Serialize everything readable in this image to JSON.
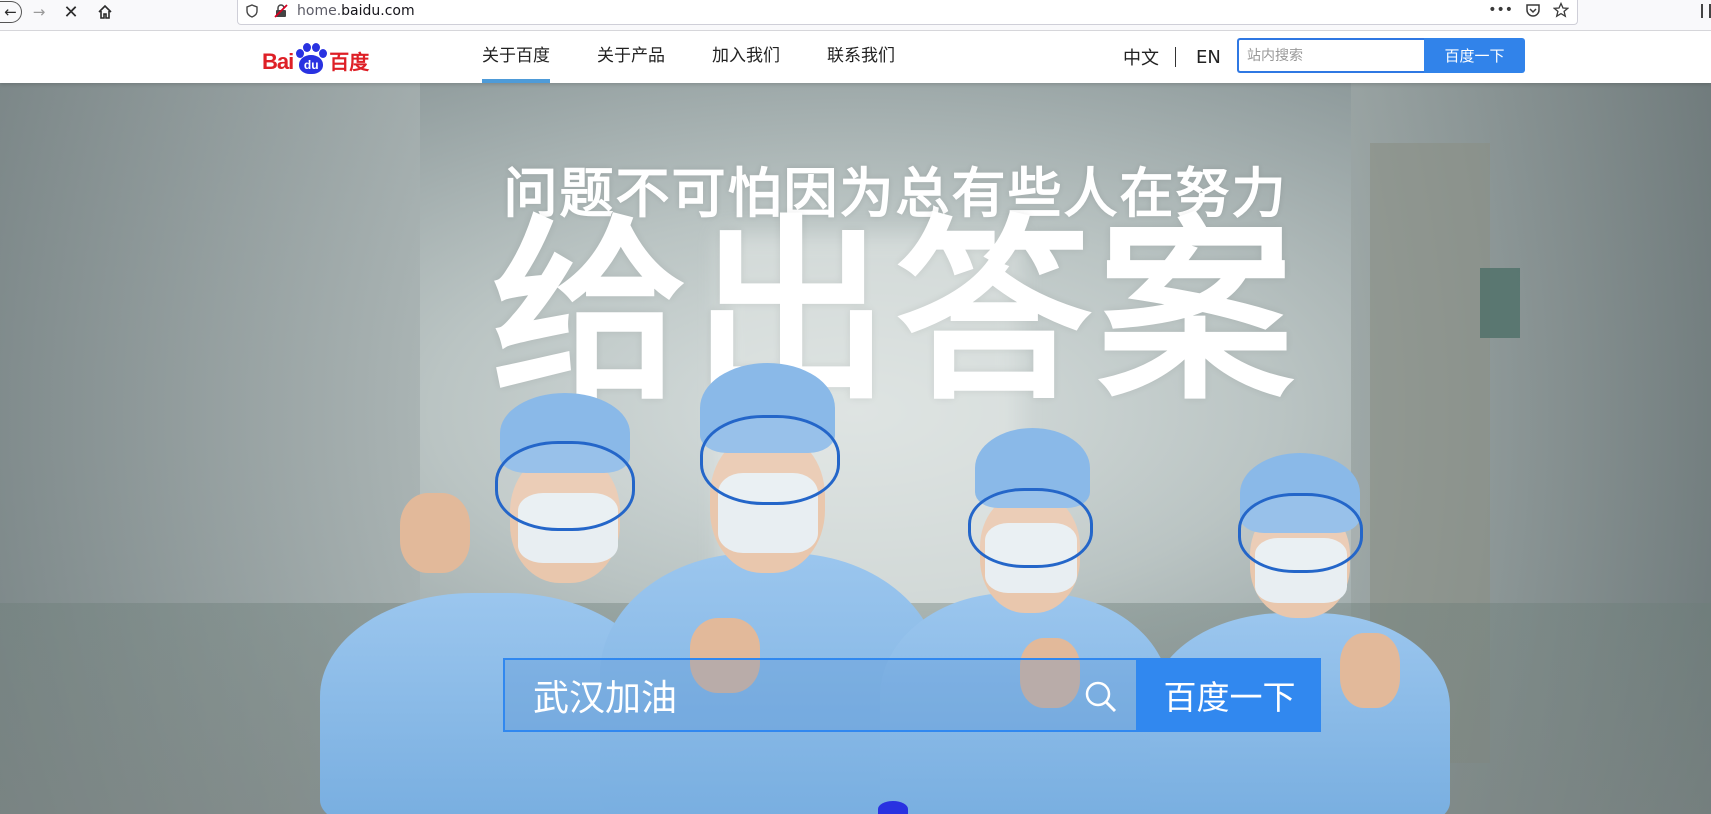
{
  "browser": {
    "url_prefix": "home.",
    "url_domain": "baidu.com",
    "icons": [
      "back-icon",
      "forward-icon",
      "stop-icon",
      "home-icon",
      "shield-icon",
      "insecure-lock-icon",
      "more-icon",
      "pocket-icon",
      "bookmark-star-icon",
      "library-icon"
    ]
  },
  "header": {
    "logo": {
      "bai": "Bai",
      "du": "du",
      "cn": "百度"
    },
    "nav": [
      {
        "label": "关于百度",
        "active": true
      },
      {
        "label": "关于产品",
        "active": false
      },
      {
        "label": "加入我们",
        "active": false
      },
      {
        "label": "联系我们",
        "active": false
      }
    ],
    "lang_cn": "中文",
    "lang_en": "EN",
    "site_search_placeholder": "站内搜索",
    "site_search_button": "百度一下"
  },
  "hero": {
    "subtitle": "问题不可怕因为总有些人在努力",
    "title": "给出答案",
    "search_value": "武汉加油",
    "search_button": "百度一下"
  },
  "colors": {
    "accent": "#3188ef",
    "nav_underline": "#4e9bd8",
    "logo_red": "#de1f26",
    "logo_blue": "#2932e1"
  }
}
